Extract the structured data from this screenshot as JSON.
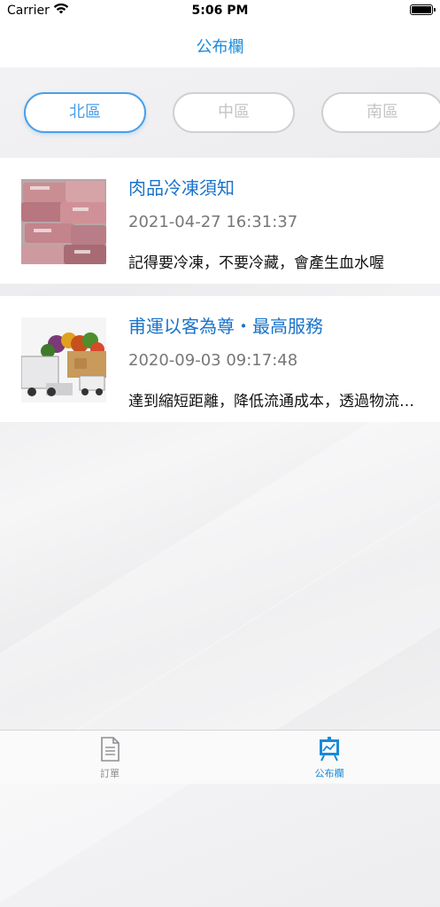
{
  "status_bar": {
    "carrier": "Carrier",
    "time": "5:06 PM"
  },
  "nav": {
    "title": "公布欄"
  },
  "region_tabs": [
    {
      "label": "北區",
      "active": true
    },
    {
      "label": "中區",
      "active": false
    },
    {
      "label": "南區",
      "active": false
    }
  ],
  "posts": [
    {
      "title": "肉品冷凍須知",
      "date": "2021-04-27 16:31:37",
      "desc": "記得要冷凍，不要冷藏，會產生血水喔",
      "thumb_icon": "frozen-meat-image"
    },
    {
      "title": "甫運以客為尊・最高服務",
      "date": "2020-09-03 09:17:48",
      "desc": "達到縮短距離，降低流通成本，透過物流配送",
      "thumb_icon": "delivery-truck-image"
    }
  ],
  "tab_bar": {
    "items": [
      {
        "label": "訂單",
        "icon": "document-icon",
        "active": false
      },
      {
        "label": "公布欄",
        "icon": "board-icon",
        "active": true
      }
    ]
  },
  "colors": {
    "accent": "#1a8ad8",
    "active_tab_border": "#4a9fe8",
    "inactive": "#c4c4c4",
    "title_blue": "#1a73c9"
  }
}
